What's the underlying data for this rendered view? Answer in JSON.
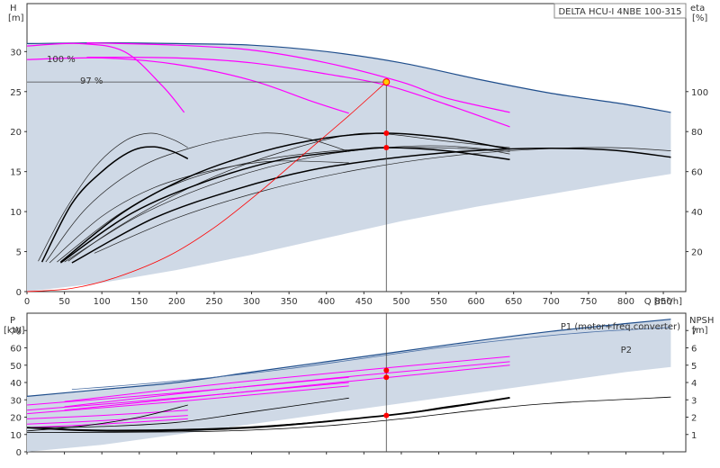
{
  "title": "DELTA HCU-I 4NBE 100-315",
  "colors": {
    "envelope": "#cfd9e6",
    "envelope_edge": "#1f4e8c",
    "magenta": "#ff00ff",
    "black": "#000000",
    "red": "#ff0000",
    "dot_yellow": "#ffcc00"
  },
  "chart_data": [
    {
      "type": "line",
      "name": "head",
      "xlabel": "Q [m³/h]",
      "ylabel_left": [
        "H",
        "[m]"
      ],
      "ylabel_right": [
        "eta",
        "[%]"
      ],
      "xlim": [
        0,
        880
      ],
      "ylim": [
        0,
        36
      ],
      "y2lim": [
        0,
        144
      ],
      "xticks": [
        0,
        50,
        100,
        150,
        200,
        250,
        300,
        350,
        400,
        450,
        500,
        550,
        600,
        650,
        700,
        750,
        800,
        850
      ],
      "yticks": [
        0,
        5,
        10,
        15,
        20,
        25,
        30
      ],
      "y2ticks": [
        20,
        40,
        60,
        80,
        100
      ],
      "grid": false,
      "annotations": [
        "100 %",
        "97 %"
      ],
      "envelope": [
        [
          0,
          31
        ],
        [
          100,
          31.1
        ],
        [
          200,
          31
        ],
        [
          300,
          30.8
        ],
        [
          400,
          30
        ],
        [
          500,
          28.6
        ],
        [
          600,
          26.6
        ],
        [
          700,
          24.8
        ],
        [
          800,
          23.4
        ],
        [
          860,
          22.4
        ],
        [
          860,
          14.7
        ],
        [
          800,
          13.8
        ],
        [
          700,
          12.2
        ],
        [
          600,
          10.6
        ],
        [
          500,
          8.8
        ],
        [
          400,
          6.7
        ],
        [
          300,
          4.6
        ],
        [
          200,
          2.7
        ],
        [
          100,
          1.1
        ],
        [
          0,
          0
        ]
      ],
      "magenta": [
        [
          [
            0,
            30.7
          ],
          [
            70,
            31
          ],
          [
            130,
            30
          ],
          [
            180,
            25.8
          ],
          [
            210,
            22.4
          ]
        ],
        [
          [
            0,
            29
          ],
          [
            100,
            29.2
          ],
          [
            200,
            28.4
          ],
          [
            300,
            26.4
          ],
          [
            380,
            23.8
          ],
          [
            430,
            22.3
          ]
        ],
        [
          [
            80,
            31.1
          ],
          [
            200,
            30.8
          ],
          [
            300,
            30.2
          ],
          [
            400,
            28.6
          ],
          [
            500,
            26.2
          ],
          [
            560,
            24.2
          ],
          [
            645,
            22.4
          ]
        ],
        [
          [
            80,
            29.3
          ],
          [
            200,
            29.2
          ],
          [
            300,
            28.6
          ],
          [
            400,
            27.2
          ],
          [
            480,
            25.8
          ],
          [
            560,
            23.4
          ],
          [
            645,
            20.6
          ]
        ]
      ],
      "black_thin": [
        [
          [
            15,
            3.8
          ],
          [
            50,
            10
          ],
          [
            90,
            15.5
          ],
          [
            130,
            18.8
          ],
          [
            165,
            19.8
          ],
          [
            195,
            19
          ],
          [
            215,
            18
          ]
        ],
        [
          [
            25,
            3.7
          ],
          [
            80,
            10.5
          ],
          [
            150,
            15.5
          ],
          [
            220,
            18
          ],
          [
            290,
            19.5
          ],
          [
            330,
            19.8
          ],
          [
            380,
            19
          ],
          [
            430,
            17.5
          ]
        ],
        [
          [
            40,
            3.7
          ],
          [
            120,
            9.5
          ],
          [
            200,
            13.5
          ],
          [
            300,
            16.2
          ],
          [
            400,
            17.5
          ],
          [
            500,
            18
          ],
          [
            600,
            17.8
          ],
          [
            645,
            17.2
          ]
        ],
        [
          [
            50,
            3.7
          ],
          [
            150,
            9.5
          ],
          [
            260,
            13.8
          ],
          [
            380,
            16.8
          ],
          [
            480,
            18
          ],
          [
            560,
            18.2
          ],
          [
            645,
            17.5
          ]
        ],
        [
          [
            90,
            4.8
          ],
          [
            200,
            9.2
          ],
          [
            320,
            12.7
          ],
          [
            440,
            15.2
          ],
          [
            560,
            16.9
          ],
          [
            680,
            17.8
          ],
          [
            780,
            18
          ],
          [
            860,
            17.6
          ]
        ],
        [
          [
            55,
            3.8
          ],
          [
            120,
            8
          ],
          [
            200,
            12.2
          ],
          [
            280,
            15.5
          ],
          [
            360,
            18
          ],
          [
            430,
            19.6
          ],
          [
            480,
            19.7
          ],
          [
            560,
            18.8
          ],
          [
            645,
            18
          ]
        ],
        [
          [
            30,
            3.6
          ],
          [
            100,
            9.4
          ],
          [
            170,
            13
          ],
          [
            250,
            15.2
          ],
          [
            330,
            16.3
          ],
          [
            430,
            16.1
          ]
        ]
      ],
      "black_thick": [
        [
          [
            20,
            3.7
          ],
          [
            60,
            11
          ],
          [
            100,
            15
          ],
          [
            140,
            17.6
          ],
          [
            170,
            18.1
          ],
          [
            195,
            17.5
          ],
          [
            215,
            16.6
          ]
        ],
        [
          [
            45,
            3.7
          ],
          [
            130,
            10
          ],
          [
            220,
            14.5
          ],
          [
            310,
            17.4
          ],
          [
            400,
            19.2
          ],
          [
            480,
            19.8
          ],
          [
            560,
            19.2
          ],
          [
            645,
            17.8
          ]
        ],
        [
          [
            45,
            3.6
          ],
          [
            140,
            9.8
          ],
          [
            240,
            13.8
          ],
          [
            340,
            16.5
          ],
          [
            430,
            17.6
          ],
          [
            480,
            18
          ],
          [
            560,
            17.6
          ],
          [
            645,
            16.5
          ]
        ],
        [
          [
            60,
            3.6
          ],
          [
            170,
            9.2
          ],
          [
            280,
            12.8
          ],
          [
            380,
            15.2
          ],
          [
            480,
            16.6
          ],
          [
            580,
            17.5
          ],
          [
            680,
            17.9
          ],
          [
            780,
            17.7
          ],
          [
            860,
            16.8
          ]
        ]
      ],
      "red_curve": [
        [
          0,
          0
        ],
        [
          60,
          0.4
        ],
        [
          120,
          1.8
        ],
        [
          190,
          4.5
        ],
        [
          250,
          8
        ],
        [
          310,
          12.4
        ],
        [
          370,
          17.2
        ],
        [
          430,
          22
        ],
        [
          480,
          26.2
        ]
      ],
      "operating_point": {
        "x": 480,
        "y": 26.2
      },
      "marker_points": [
        {
          "x": 480,
          "y": 19.8
        },
        {
          "x": 480,
          "y": 18
        }
      ]
    },
    {
      "type": "line",
      "name": "power",
      "ylabel_left": [
        "P",
        "[kW]"
      ],
      "ylabel_right": [
        "NPSH",
        "[m]"
      ],
      "xlim": [
        0,
        880
      ],
      "ylim": [
        0,
        80
      ],
      "y2lim": [
        0,
        8
      ],
      "yticks": [
        0,
        10,
        20,
        30,
        40,
        50,
        60,
        70
      ],
      "y2ticks": [
        1,
        2,
        3,
        4,
        5,
        6,
        7
      ],
      "legend": [
        "P1 (motor+freq.converter)",
        "P2"
      ],
      "grid": false,
      "P1_envelope": [
        [
          0,
          32
        ],
        [
          100,
          36
        ],
        [
          200,
          40
        ],
        [
          300,
          46
        ],
        [
          400,
          52
        ],
        [
          500,
          58
        ],
        [
          600,
          64
        ],
        [
          700,
          69.5
        ],
        [
          800,
          74
        ],
        [
          860,
          76.5
        ],
        [
          860,
          49
        ],
        [
          800,
          46
        ],
        [
          700,
          40
        ],
        [
          600,
          34
        ],
        [
          500,
          28
        ],
        [
          400,
          22
        ],
        [
          300,
          16
        ],
        [
          200,
          10
        ],
        [
          100,
          4
        ],
        [
          0,
          0
        ]
      ],
      "P2_line": [
        [
          60,
          36
        ],
        [
          150,
          39
        ],
        [
          250,
          43
        ],
        [
          350,
          48
        ],
        [
          450,
          54
        ],
        [
          550,
          60
        ],
        [
          650,
          65
        ],
        [
          750,
          69
        ],
        [
          860,
          71.8
        ]
      ],
      "magenta_lines": [
        [
          [
            0,
            22
          ],
          [
            200,
            29
          ],
          [
            430,
            38
          ]
        ],
        [
          [
            0,
            24
          ],
          [
            200,
            31
          ],
          [
            430,
            40
          ]
        ],
        [
          [
            0,
            27
          ],
          [
            200,
            34
          ],
          [
            430,
            43
          ]
        ],
        [
          [
            50,
            29
          ],
          [
            300,
            41
          ],
          [
            645,
            55
          ]
        ],
        [
          [
            50,
            26
          ],
          [
            300,
            38
          ],
          [
            645,
            52
          ]
        ],
        [
          [
            50,
            24
          ],
          [
            300,
            35
          ],
          [
            645,
            50
          ]
        ],
        [
          [
            0,
            14
          ],
          [
            100,
            16
          ],
          [
            215,
            19
          ]
        ],
        [
          [
            0,
            16
          ],
          [
            100,
            18
          ],
          [
            215,
            21
          ]
        ],
        [
          [
            0,
            19
          ],
          [
            100,
            21
          ],
          [
            215,
            24
          ]
        ]
      ],
      "black_lines": [
        [
          [
            0,
            11.2
          ],
          [
            100,
            11.2
          ],
          [
            200,
            11.5
          ],
          [
            300,
            12.5
          ],
          [
            400,
            15
          ],
          [
            500,
            19
          ],
          [
            600,
            24
          ],
          [
            700,
            28
          ],
          [
            860,
            31.6
          ]
        ],
        [
          [
            0,
            14
          ],
          [
            120,
            12.5
          ],
          [
            300,
            14.5
          ],
          [
            480,
            21
          ],
          [
            560,
            26
          ],
          [
            645,
            31
          ]
        ],
        [
          [
            0,
            14
          ],
          [
            100,
            14.6
          ],
          [
            200,
            17
          ],
          [
            300,
            23
          ],
          [
            430,
            31
          ]
        ],
        [
          [
            0,
            12
          ],
          [
            80,
            15.2
          ],
          [
            150,
            20
          ],
          [
            215,
            27
          ]
        ]
      ],
      "black_thick_line": [
        [
          0,
          14
        ],
        [
          120,
          12
        ],
        [
          300,
          14
        ],
        [
          480,
          21
        ],
        [
          560,
          25.5
        ],
        [
          645,
          31.2
        ]
      ],
      "marker_points": [
        {
          "x": 480,
          "y": 47
        },
        {
          "x": 480,
          "y": 43
        },
        {
          "x": 480,
          "y": 21
        }
      ]
    }
  ]
}
